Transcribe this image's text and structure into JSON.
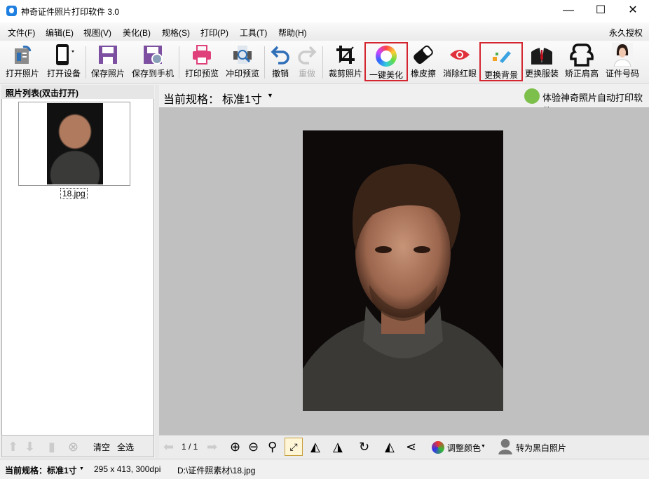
{
  "window": {
    "title": "神奇证件照片打印软件 3.0",
    "minimize": "—",
    "maximize": "☐",
    "close": "✕"
  },
  "menu": [
    "文件(F)",
    "编辑(E)",
    "视图(V)",
    "美化(B)",
    "规格(S)",
    "打印(P)",
    "工具(T)",
    "帮助(H)"
  ],
  "license": "永久授权",
  "toolbar": [
    {
      "label": "打开照片",
      "icon": "open-photo-icon"
    },
    {
      "label": "打开设备",
      "icon": "phone-device-icon"
    },
    {
      "label": "保存照片",
      "icon": "save-icon"
    },
    {
      "label": "保存到手机",
      "icon": "save-to-phone-icon"
    },
    {
      "label": "打印预览",
      "icon": "printer-icon"
    },
    {
      "label": "冲印预览",
      "icon": "print-search-icon"
    },
    {
      "label": "撤销",
      "icon": "undo-icon"
    },
    {
      "label": "重做",
      "icon": "redo-icon",
      "disabled": true
    },
    {
      "label": "裁剪照片",
      "icon": "crop-icon"
    },
    {
      "label": "一键美化",
      "icon": "color-ring-icon",
      "highlighted": true
    },
    {
      "label": "橡皮擦",
      "icon": "eraser-icon"
    },
    {
      "label": "消除红眼",
      "icon": "eye-icon"
    },
    {
      "label": "更换背景",
      "icon": "change-background-icon",
      "highlighted": true
    },
    {
      "label": "更换服装",
      "icon": "suit-icon"
    },
    {
      "label": "矫正肩高",
      "icon": "shoulder-icon"
    },
    {
      "label": "证件号码",
      "icon": "id-photo-icon"
    }
  ],
  "left_panel": {
    "title": "照片列表(双击打开)",
    "files": [
      "18.jpg"
    ],
    "clear": "清空",
    "select_all": "全选"
  },
  "main": {
    "spec_label": "当前规格：",
    "spec_value": "标准1寸",
    "promo": "体验神奇照片自动打印软件"
  },
  "bottom_bar": {
    "page": "1 / 1",
    "adjust_color": "调整颜色",
    "to_bw": "转为黑白照片"
  },
  "status": {
    "spec": "当前规格：标准1寸",
    "size": "295 x 413, 300dpi",
    "path": "D:\\证件照素材\\18.jpg"
  },
  "colors": {
    "highlight": "#d42630",
    "canvas": "#c0c0c0"
  }
}
